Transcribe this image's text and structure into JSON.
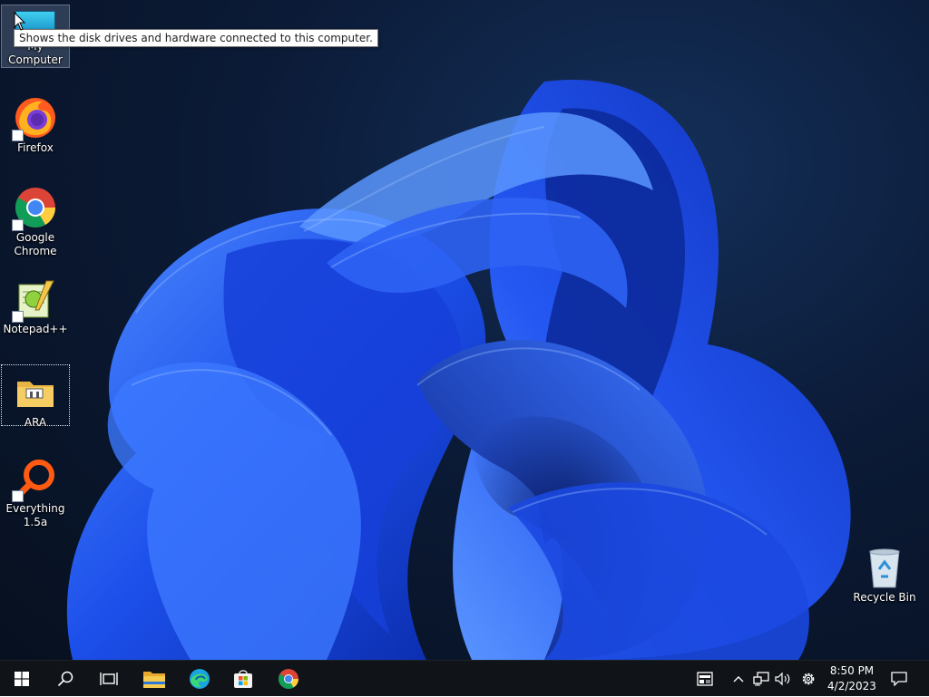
{
  "desktop": {
    "tooltip": "Shows the disk drives and hardware connected to this computer.",
    "icons": [
      {
        "label": "My Computer",
        "icon": "computer-icon"
      },
      {
        "label": "Firefox",
        "icon": "firefox-icon"
      },
      {
        "label": "Google Chrome",
        "icon": "chrome-icon"
      },
      {
        "label": "Notepad++",
        "icon": "notepad-plus-plus-icon"
      },
      {
        "label": "ARA",
        "icon": "folder-icon"
      },
      {
        "label": "Everything 1.5a",
        "icon": "everything-search-icon"
      },
      {
        "label": "Recycle Bin",
        "icon": "recycle-bin-icon"
      }
    ]
  },
  "taskbar": {
    "buttons": [
      {
        "name": "start-button",
        "icon": "windows-logo-icon"
      },
      {
        "name": "search-button",
        "icon": "search-icon"
      },
      {
        "name": "task-view-button",
        "icon": "task-view-icon"
      },
      {
        "name": "file-explorer-button",
        "icon": "file-explorer-icon"
      },
      {
        "name": "edge-button",
        "icon": "edge-icon"
      },
      {
        "name": "store-button",
        "icon": "microsoft-store-icon"
      },
      {
        "name": "chrome-button",
        "icon": "chrome-icon"
      }
    ],
    "tray": {
      "icons": [
        "news-widget-icon",
        "chevron-up-icon",
        "network-icon",
        "volume-icon",
        "settings-gear-icon"
      ],
      "time": "8:50 PM",
      "date": "4/2/2023",
      "notification_icon": "action-center-icon"
    }
  },
  "colors": {
    "taskbar_bg": "#101318",
    "wallpaper_blue": "#1f4fe8",
    "desktop_bg": "#0b1a36"
  }
}
